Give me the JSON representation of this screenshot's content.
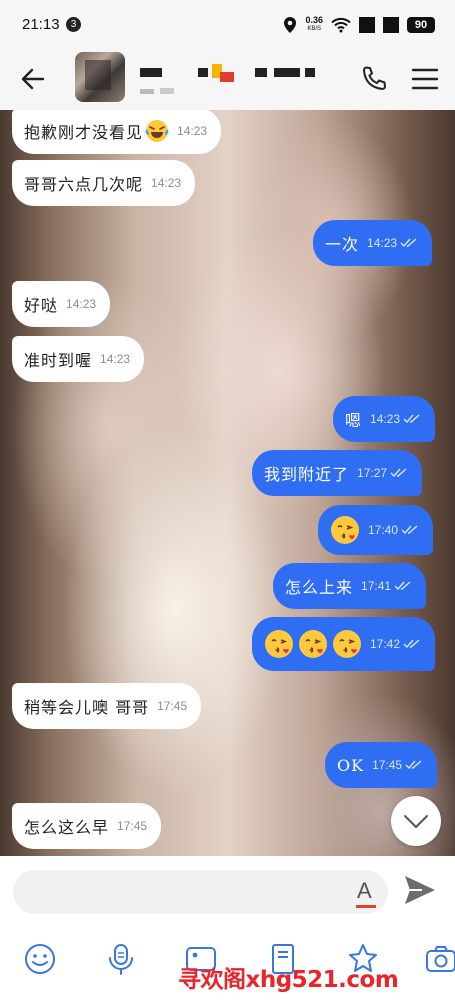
{
  "status_bar": {
    "time": "21:13",
    "notification_count": "3",
    "net_speed": "0.36",
    "net_unit": "KB/S",
    "battery": "90"
  },
  "header": {
    "back_icon": "arrow-left-icon",
    "call_icon": "phone-icon",
    "menu_icon": "hamburger-menu-icon"
  },
  "messages": [
    {
      "dir": "in",
      "text": "抱歉刚才没看见",
      "emoji": "laughing",
      "time": "14:23"
    },
    {
      "dir": "in",
      "text": "哥哥六点几次呢",
      "time": "14:23"
    },
    {
      "dir": "out",
      "text": "一次",
      "time": "14:23"
    },
    {
      "dir": "in",
      "text": "好哒",
      "time": "14:23"
    },
    {
      "dir": "in",
      "text": "准时到喔",
      "time": "14:23"
    },
    {
      "dir": "out",
      "text": "嗯",
      "time": "14:23"
    },
    {
      "dir": "out",
      "text": "我到附近了",
      "time": "17:27"
    },
    {
      "dir": "out",
      "emoji_count": 1,
      "time": "17:40"
    },
    {
      "dir": "out",
      "text": "怎么上来",
      "time": "17:41"
    },
    {
      "dir": "out",
      "emoji_count": 3,
      "time": "17:42"
    },
    {
      "dir": "in",
      "text": "稍等会儿噢 哥哥",
      "time": "17:45"
    },
    {
      "dir": "out",
      "text": "OK",
      "time": "17:45"
    },
    {
      "dir": "in",
      "text": "怎么这么早",
      "time": "17:45"
    }
  ],
  "colors": {
    "outgoing_bubble": "#2f6ef2",
    "incoming_bubble": "#ffffff",
    "watermark": "#e8252a"
  },
  "composer": {
    "placeholder": "",
    "format_label": "A",
    "send_icon": "send-icon"
  },
  "toolbar": [
    "emoji-icon",
    "microphone-icon",
    "image-icon",
    "document-icon",
    "sticker-icon",
    "camera-icon"
  ],
  "watermark": "寻欢阁xhg521.com"
}
